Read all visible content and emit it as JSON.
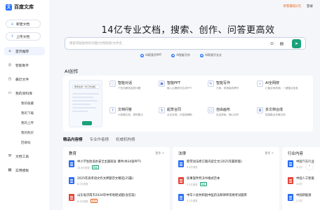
{
  "brand": {
    "logo_mark": "文",
    "name": "百度文库"
  },
  "top_bar": {
    "vip_label": "新客最低2元",
    "login_label": "登录"
  },
  "sidebar": {
    "new_doc": "新建文档",
    "upload_doc": "上传文档",
    "nav": [
      {
        "label": "首页推荐",
        "icon": "home-icon",
        "active": true
      },
      {
        "label": "智能助手",
        "icon": "assistant-icon",
        "active": false
      },
      {
        "label": "最近文件",
        "icon": "clock-icon",
        "active": false
      },
      {
        "label": "我的资料库",
        "icon": "folder-icon",
        "active": false
      }
    ],
    "library_items": [
      "我的收藏",
      "我的下载",
      "我的上传",
      "我的购买",
      "回收站"
    ],
    "bottom_nav": [
      {
        "label": "文档工具",
        "icon": "tools-icon"
      },
      {
        "label": "实用模板",
        "icon": "template-icon"
      }
    ]
  },
  "hero": {
    "title": "14亿专业文档，搜索、创作、问答更高效",
    "search_placeholder": "搜索或粘贴你的问题/文档链接/文件名",
    "quick_tags": [
      "AI帮我写PPT",
      "AI智能写作",
      "AI帮我写长文"
    ]
  },
  "ai_section": {
    "title": "AI创作",
    "preview_label": "帮你生成一份工作总结",
    "cards": [
      {
        "icon": "chat-icon",
        "title": "智能对话",
        "desc": "个性化解答各类问题"
      },
      {
        "icon": "ppt-icon",
        "title": "智能PPT",
        "desc": "输入主题即可生成PPT"
      },
      {
        "icon": "write-icon",
        "title": "智能写作",
        "desc": "方案、研报高效撰写"
      },
      {
        "icon": "merge-icon",
        "title": "AI全网搜",
        "desc": "汇聚全网资源，一键整合信息"
      },
      {
        "icon": "qa-icon",
        "title": "文档问答",
        "desc": "AI读懂文档，提炼要点"
      },
      {
        "icon": "contract-icon",
        "title": "起草合同",
        "desc": "合法合规，AI智能辅助"
      },
      {
        "icon": "canvas-icon",
        "title": "自由画布",
        "desc": "自由排版，随心创作"
      },
      {
        "icon": "combine-icon",
        "title": "多文档合成",
        "desc": "智能融合多篇文档"
      },
      {
        "icon": "more-icon",
        "title": "更多AI能力",
        "desc": "发现更多实用工具"
      }
    ]
  },
  "content_tabs": [
    "精品内容榜",
    "专业作者榜",
    "权威机构榜"
  ],
  "content_cards": [
    {
      "title": "教育",
      "more": "更多 >",
      "docs": [
        {
          "title": "中小学生防溺水安全主题班会 课件(共34张PPT)",
          "meta": "10.8万浏览",
          "badge": "精选",
          "type": "ppt"
        },
        {
          "title": "2025年高考语文作文押题范文精选(25篇)",
          "meta": "8.2万浏览",
          "badge": "",
          "type": "doc"
        },
        {
          "title": "山东省济南市2024年中考地理试题(含答案)",
          "meta": "6.5万浏览",
          "badge": "真题",
          "type": "pdf"
        }
      ]
    },
    {
      "title": "法律",
      "more": "更多 >",
      "docs": [
        {
          "title": "新劳动法修订版内容全文(2025年最新版)",
          "meta": "9.4万浏览",
          "badge": "",
          "type": "doc"
        },
        {
          "title": "民事案件判决书格式范本",
          "meta": "5.3万浏览",
          "badge": "精选",
          "type": "pdf"
        },
        {
          "title": "中华人民共和国中医药法和律师资格考试题库",
          "meta": "4.1万浏览",
          "badge": "",
          "type": "doc"
        }
      ]
    },
    {
      "title": "行业内容",
      "more": "",
      "docs": [
        {
          "title": "中国汽车行业",
          "meta": "3.1万",
          "badge": "",
          "type": "doc"
        },
        {
          "title": "中国人工智能",
          "meta": "2.8万",
          "badge": "",
          "type": "pdf"
        },
        {
          "title": "中国新能源",
          "meta": "2.2万",
          "badge": "",
          "type": "doc"
        }
      ]
    }
  ]
}
